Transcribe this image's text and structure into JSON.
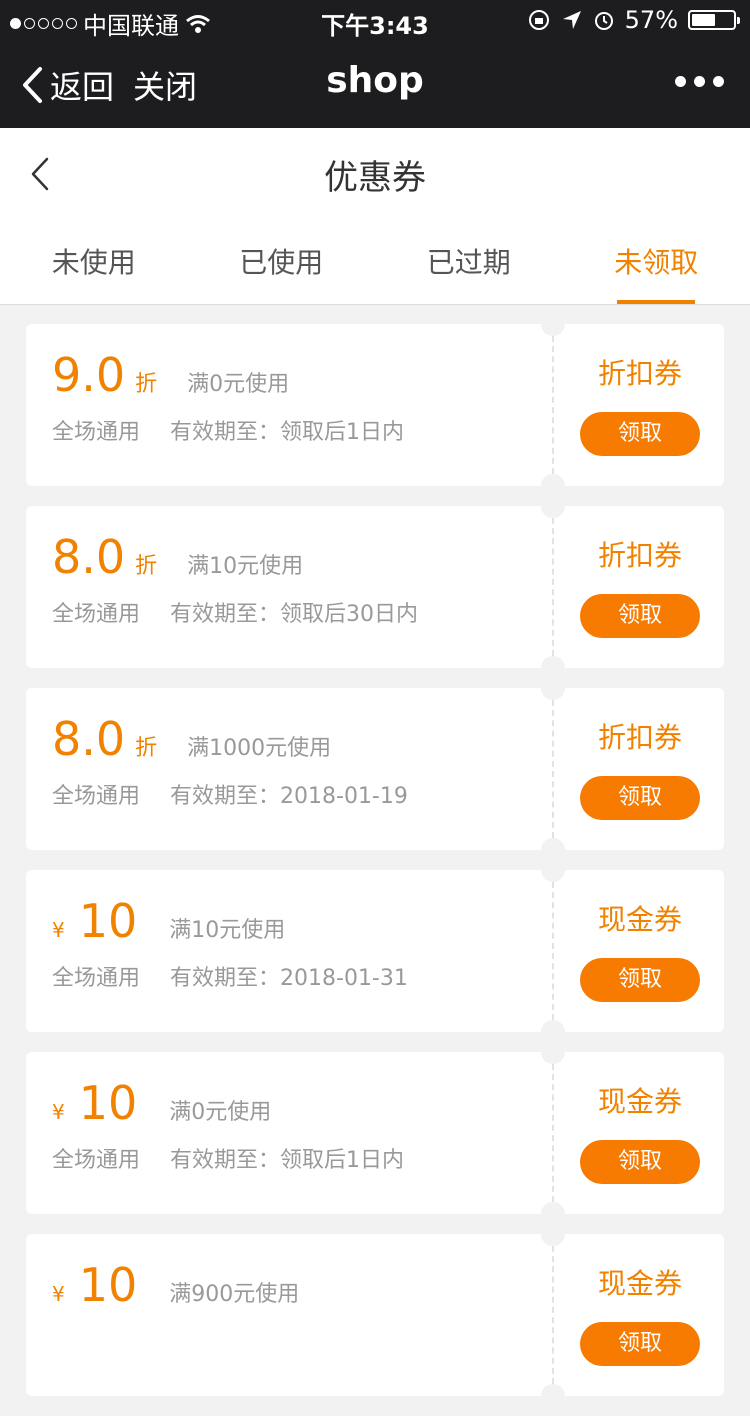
{
  "status_bar": {
    "carrier": "中国联通",
    "time": "下午3:43",
    "battery": "57%",
    "battery_level": 0.57
  },
  "wechat_nav": {
    "back_label": "返回",
    "close_label": "关闭",
    "title": "shop"
  },
  "page": {
    "title": "优惠券"
  },
  "tabs": [
    {
      "label": "未使用"
    },
    {
      "label": "已使用"
    },
    {
      "label": "已过期"
    },
    {
      "label": "未领取"
    }
  ],
  "active_tab_index": 3,
  "accent_color": "#f08200",
  "coupons": [
    {
      "kind": "discount",
      "value": "9.0",
      "unit": "折",
      "condition": "满0元使用",
      "scope": "全场通用",
      "validity": "有效期至：领取后1日内",
      "type_label": "折扣券",
      "action": "领取"
    },
    {
      "kind": "discount",
      "value": "8.0",
      "unit": "折",
      "condition": "满10元使用",
      "scope": "全场通用",
      "validity": "有效期至：领取后30日内",
      "type_label": "折扣券",
      "action": "领取"
    },
    {
      "kind": "discount",
      "value": "8.0",
      "unit": "折",
      "condition": "满1000元使用",
      "scope": "全场通用",
      "validity": "有效期至：2018-01-19",
      "type_label": "折扣券",
      "action": "领取"
    },
    {
      "kind": "cash",
      "currency": "¥",
      "value": "10",
      "condition": "满10元使用",
      "scope": "全场通用",
      "validity": "有效期至：2018-01-31",
      "type_label": "现金券",
      "action": "领取"
    },
    {
      "kind": "cash",
      "currency": "¥",
      "value": "10",
      "condition": "满0元使用",
      "scope": "全场通用",
      "validity": "有效期至：领取后1日内",
      "type_label": "现金券",
      "action": "领取"
    },
    {
      "kind": "cash",
      "currency": "¥",
      "value": "10",
      "condition": "满900元使用",
      "scope": "",
      "validity": "",
      "type_label": "现金券",
      "action": "领取"
    }
  ]
}
